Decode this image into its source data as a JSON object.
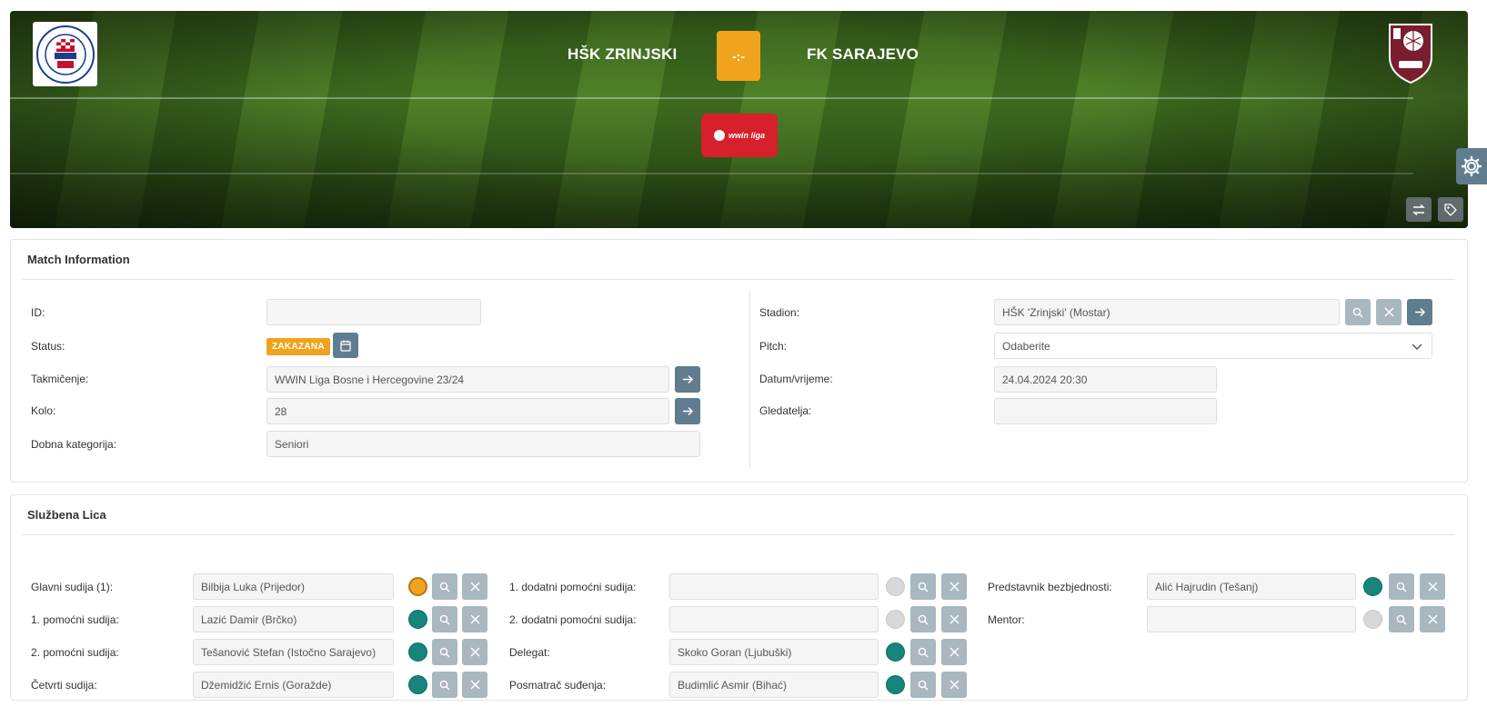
{
  "header": {
    "home_team": "HŠK ZRINJSKI",
    "away_team": "FK SARAJEVO",
    "score": "-:-",
    "home_crest_text": "HRVATSKI ŠPORTSKI KLUB ZRINJSKI MOSTAR",
    "away_crest_text": "FK SARAJEVO 1946",
    "league_logo_text": "wwin liga",
    "colors": {
      "score_bg": "#f0a31c",
      "league_logo_bg": "#d6202b"
    }
  },
  "match_info": {
    "title": "Match Information",
    "id_label": "ID:",
    "id_value": "",
    "status_label": "Status:",
    "status_badge": "ZAKAZANA",
    "competition_label": "Takmičenje:",
    "competition_value": "WWIN Liga Bosne i Hercegovine 23/24",
    "round_label": "Kolo:",
    "round_value": "28",
    "age_label": "Dobna kategorija:",
    "age_value": "Seniori",
    "stadium_label": "Stadion:",
    "stadium_value": "HŠK 'Zrinjski' (Mostar)",
    "pitch_label": "Pitch:",
    "pitch_value": "Odaberite",
    "datetime_label": "Datum/vrijeme:",
    "datetime_value": "24.04.2024 20:30",
    "spectators_label": "Gledatelja:",
    "spectators_value": ""
  },
  "officials": {
    "title": "Službena Lica",
    "rows": [
      {
        "label": "Glavni sudija (1):",
        "value": "Bilbija Luka (Prijedor)",
        "status": "orange"
      },
      {
        "label": "1. pomoćni sudija:",
        "value": "Lazić Damir (Brčko)",
        "status": "green"
      },
      {
        "label": "2. pomoćni sudija:",
        "value": "Tešanović Stefan (Istočno Sarajevo)",
        "status": "green"
      },
      {
        "label": "Četvrti sudija:",
        "value": "Džemidžić Ernis (Goražde)",
        "status": "green"
      },
      {
        "label": "1. dodatni pomoćni sudija:",
        "value": "",
        "status": "gray"
      },
      {
        "label": "2. dodatni pomoćni sudija:",
        "value": "",
        "status": "gray"
      },
      {
        "label": "Delegat:",
        "value": "Skoko Goran (Ljubuški)",
        "status": "green"
      },
      {
        "label": "Posmatrač suđenja:",
        "value": "Budimlić Asmir (Bihać)",
        "status": "green"
      },
      {
        "label": "Predstavnik bezbjednosti:",
        "value": "Alić Hajrudin (Tešanj)",
        "status": "green"
      },
      {
        "label": "Mentor:",
        "value": "",
        "status": "gray"
      }
    ]
  },
  "icons": {
    "search": "search-icon",
    "clear": "close-icon",
    "go": "arrow-right-icon",
    "calendar": "calendar-icon",
    "settings": "gear-icon",
    "swap": "swap-icon",
    "tag": "tag-icon"
  }
}
